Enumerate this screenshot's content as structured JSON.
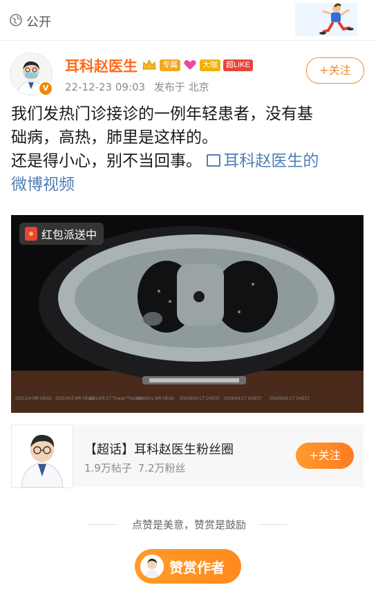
{
  "header": {
    "visibility_label": "公开"
  },
  "post": {
    "author_name": "耳科赵医生",
    "tags": [
      "专属",
      "大咖",
      "超LIKE"
    ],
    "timestamp": "22-12-23 09:03",
    "posted_from": "发布于 北京",
    "follow_label": "+关注",
    "text_line1": "我们发热门诊接诊的一例年轻患者，没有基",
    "text_line2": "础病，高热，肺里是这样的。",
    "text_line3": "还是得小心，别不当回事。",
    "video_link": "耳科赵医生的",
    "video_link_cont": "微博视频",
    "red_packet": "红包派送中"
  },
  "scan_labels": [
    "2021/1/4 MR HEAD",
    "2021/4/15 MR HEAD",
    "2021/4/9 CT Thorax^Thorax0...",
    "2020/9/21 MR HEAD",
    "2020/8/19 CT CHEST",
    "2019/5/4 CT CHEST",
    "2018/5/28 CT CHEST"
  ],
  "topic": {
    "title": "【超话】耳科赵医生粉丝圈",
    "posts": "1.9万帖子",
    "fans": "7.2万粉丝",
    "follow_label": "+关注"
  },
  "footer": {
    "slogan": "点赞是美意，赞赏是鼓励",
    "reward_label": "赞赏作者"
  },
  "colors": {
    "accent": "#ff7a22",
    "author": "#ff6a1a",
    "link": "#4f7db6"
  }
}
